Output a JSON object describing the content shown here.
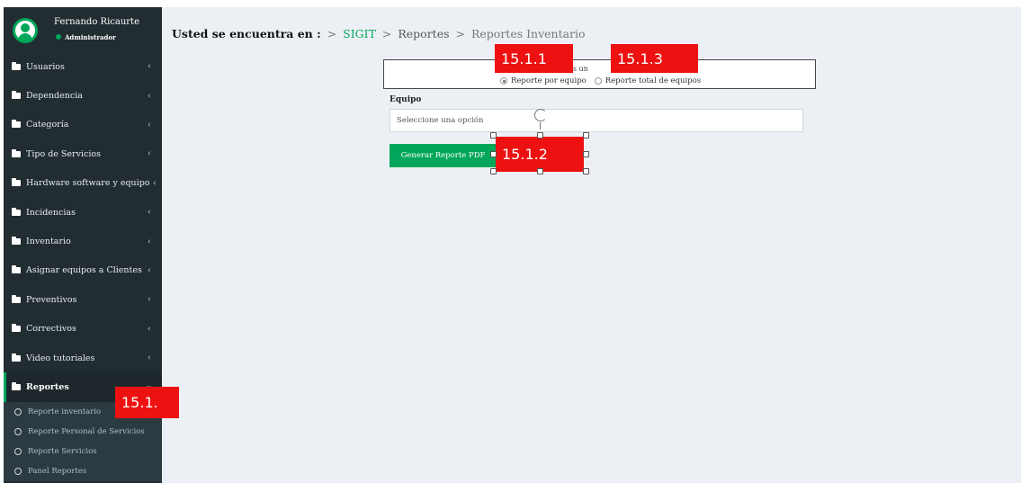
{
  "user": {
    "name": "Fernando Ricaurte",
    "role": "Administrador"
  },
  "sidebar": {
    "items": [
      {
        "label": "Usuarios"
      },
      {
        "label": "Dependencia"
      },
      {
        "label": "Categoría"
      },
      {
        "label": "Tipo de Servicios"
      },
      {
        "label": "Hardware software y equipo"
      },
      {
        "label": "Incidencias"
      },
      {
        "label": "Inventario"
      },
      {
        "label": "Asignar equipos a Clientes"
      },
      {
        "label": "Preventivos"
      },
      {
        "label": "Correctivos"
      },
      {
        "label": "Video tutoriales"
      },
      {
        "label": "Reportes"
      }
    ],
    "submenu": [
      {
        "label": "Reporte inventario"
      },
      {
        "label": "Reporte Personal de Servicios"
      },
      {
        "label": "Reporte Servicios"
      },
      {
        "label": "Panel Reportes"
      }
    ]
  },
  "breadcrumb": {
    "lead": "Usted se encuentra en :",
    "sep": ">",
    "home": "SIGIT",
    "section": "Reportes",
    "current": "Reportes Inventario"
  },
  "report_box": {
    "title_fragment": "nes un",
    "option1": "Reporte por equipo",
    "option2": "Reporte total de equipos",
    "selected": "Reporte por equipo"
  },
  "form": {
    "label": "Equipo",
    "select_value": "Seleccione una opción",
    "button": "Generar Reporte PDF"
  },
  "tags": {
    "t1": "15.1.",
    "t2": "15.1.1",
    "t3": "15.1.3",
    "t4": "15.1.2"
  },
  "colors": {
    "sidebar_bg": "#222d32",
    "accent_green": "#00a65a",
    "content_bg": "#ecf0f5",
    "tag_red": "#ee1111"
  }
}
